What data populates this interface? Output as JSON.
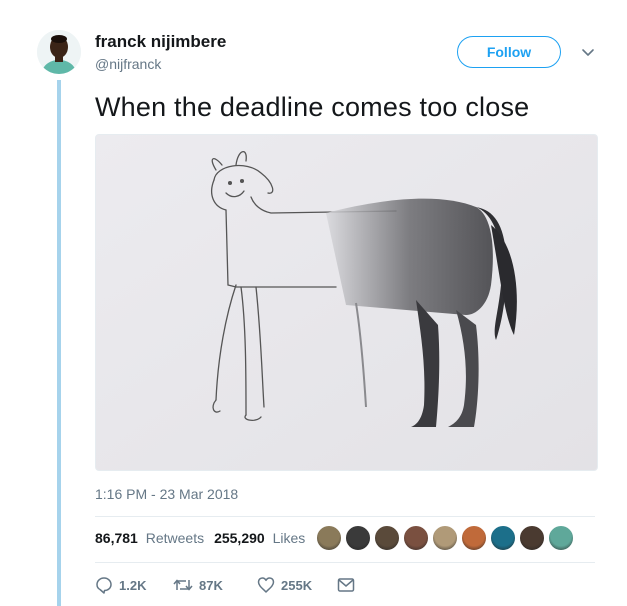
{
  "user": {
    "display_name": "franck nijimbere",
    "handle": "@nijfranck",
    "follow_label": "Follow"
  },
  "tweet": {
    "text": "When the deadline comes too close",
    "timestamp": "1:16 PM - 23 Mar 2018"
  },
  "stats": {
    "retweets_count": "86,781",
    "retweets_label": "Retweets",
    "likes_count": "255,290",
    "likes_label": "Likes",
    "liker_colors": [
      "#8a7a5a",
      "#3a3a3a",
      "#5a4a3a",
      "#7a5040",
      "#b09a78",
      "#c06a3a",
      "#1c6f8a",
      "#4a3a30",
      "#5fa89a"
    ]
  },
  "actions": {
    "reply_count": "1.2K",
    "retweet_count": "87K",
    "like_count": "255K"
  },
  "colors": {
    "accent": "#1da1f2",
    "thread_line": "#a6d3ec",
    "secondary_text": "#657786"
  }
}
